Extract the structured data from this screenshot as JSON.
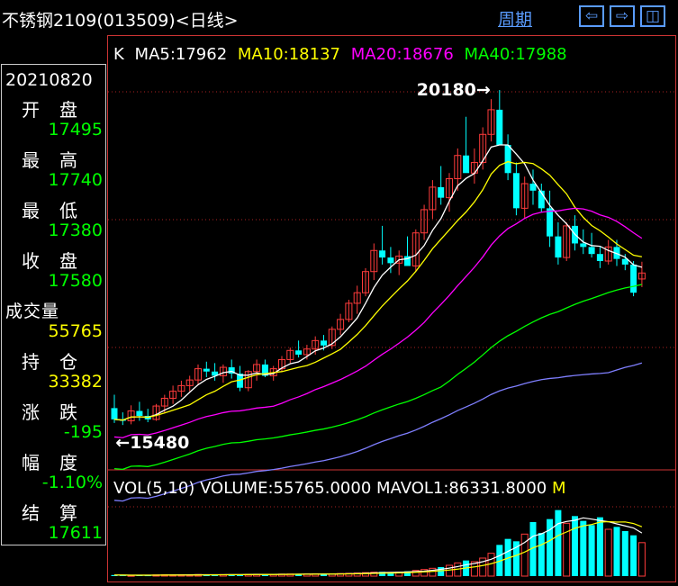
{
  "window": {
    "title": "不锈钢2109(013509)<日线>",
    "period_label": "周期",
    "btn_left": "⇦",
    "btn_right": "⇨",
    "btn_layout": "◫"
  },
  "info_panel": {
    "date": "20210820",
    "open_label": "开盘",
    "open_value": "17495",
    "high_label": "最高",
    "high_value": "17740",
    "low_label": "最低",
    "low_value": "17380",
    "close_label": "收盘",
    "close_value": "17580",
    "volume_label": "成交量",
    "volume_value": "55765",
    "oi_label": "持仓",
    "oi_value": "33382",
    "change_label": "涨跌",
    "change_value": "-195",
    "pct_label": "幅度",
    "pct_value": "-1.10%",
    "settle_label": "结算",
    "settle_value": "17611"
  },
  "colors": {
    "up": "#ff3b3b",
    "down": "#00ffff",
    "ma5": "#ffffff",
    "ma10": "#ffff00",
    "ma20": "#ff00ff",
    "ma40": "#00ff00",
    "ma60": "#7f7fff",
    "value_green": "#00ff00",
    "value_yellow": "#ffff00",
    "value_white": "#ffffff"
  },
  "chart_data": {
    "type": "candlestick",
    "legend": {
      "k": "K",
      "ma5": "MA5:17962",
      "ma10": "MA10:18137",
      "ma20": "MA20:18676",
      "ma40": "MA40:17988",
      "vol": "VOL(5,10)",
      "volume": "VOLUME:55765.0000",
      "mavol1": "MAVOL1:86331.8000",
      "cut": "M"
    },
    "annotations": {
      "max_label": "20180",
      "min_label": "15480"
    },
    "price_range": [
      15000,
      20500
    ],
    "candles": [
      [
        15660,
        15850,
        15450,
        15500
      ],
      [
        15500,
        15600,
        15420,
        15480
      ],
      [
        15480,
        15700,
        15430,
        15620
      ],
      [
        15620,
        15750,
        15480,
        15550
      ],
      [
        15550,
        15650,
        15460,
        15500
      ],
      [
        15500,
        15720,
        15480,
        15690
      ],
      [
        15690,
        15850,
        15600,
        15800
      ],
      [
        15800,
        15980,
        15720,
        15900
      ],
      [
        15900,
        16050,
        15820,
        15980
      ],
      [
        15980,
        16120,
        15900,
        16060
      ],
      [
        16060,
        16280,
        16000,
        16220
      ],
      [
        16220,
        16320,
        16100,
        16180
      ],
      [
        16180,
        16300,
        16050,
        16120
      ],
      [
        16120,
        16280,
        16020,
        16240
      ],
      [
        16240,
        16350,
        16080,
        16150
      ],
      [
        16150,
        16260,
        15900,
        15950
      ],
      [
        15950,
        16200,
        15900,
        16180
      ],
      [
        16180,
        16350,
        16050,
        16280
      ],
      [
        16280,
        16350,
        16100,
        16120
      ],
      [
        16120,
        16260,
        16050,
        16220
      ],
      [
        16220,
        16400,
        16180,
        16350
      ],
      [
        16350,
        16520,
        16300,
        16480
      ],
      [
        16480,
        16620,
        16380,
        16420
      ],
      [
        16420,
        16560,
        16350,
        16500
      ],
      [
        16500,
        16680,
        16420,
        16620
      ],
      [
        16620,
        16700,
        16480,
        16550
      ],
      [
        16550,
        16820,
        16500,
        16780
      ],
      [
        16780,
        17000,
        16700,
        16920
      ],
      [
        16920,
        17200,
        16880,
        17150
      ],
      [
        17150,
        17400,
        17000,
        17300
      ],
      [
        17300,
        17650,
        17250,
        17600
      ],
      [
        17600,
        18000,
        17480,
        17900
      ],
      [
        17900,
        18250,
        17700,
        17800
      ],
      [
        17800,
        17950,
        17580,
        17720
      ],
      [
        17720,
        17900,
        17550,
        17820
      ],
      [
        17820,
        18100,
        17700,
        17680
      ],
      [
        17680,
        18200,
        17600,
        18150
      ],
      [
        18150,
        18550,
        18050,
        18480
      ],
      [
        18480,
        18900,
        18350,
        18800
      ],
      [
        18800,
        19100,
        18550,
        18650
      ],
      [
        18650,
        19000,
        18450,
        18920
      ],
      [
        18920,
        19350,
        18750,
        19250
      ],
      [
        19250,
        19800,
        19050,
        19000
      ],
      [
        19000,
        19350,
        18850,
        19150
      ],
      [
        19150,
        19650,
        19050,
        19550
      ],
      [
        19550,
        20050,
        19450,
        19900
      ],
      [
        19900,
        20180,
        19550,
        19400
      ],
      [
        19400,
        19550,
        18900,
        19000
      ],
      [
        19000,
        19150,
        18400,
        18500
      ],
      [
        18500,
        18950,
        18350,
        18850
      ],
      [
        18850,
        19050,
        18550,
        18750
      ],
      [
        18750,
        18850,
        18450,
        18500
      ],
      [
        18500,
        18750,
        17950,
        18100
      ],
      [
        18100,
        18300,
        17700,
        17800
      ],
      [
        17800,
        18300,
        17750,
        18250
      ],
      [
        18250,
        18400,
        17900,
        18000
      ],
      [
        18000,
        18200,
        17850,
        17950
      ],
      [
        17950,
        18150,
        17800,
        17850
      ],
      [
        17850,
        17950,
        17650,
        17750
      ],
      [
        17750,
        18050,
        17700,
        17950
      ],
      [
        17950,
        18050,
        17680,
        17780
      ],
      [
        17780,
        17850,
        17620,
        17700
      ],
      [
        17700,
        17750,
        17250,
        17300
      ],
      [
        17495,
        17740,
        17380,
        17580
      ]
    ],
    "volumes": [
      1800,
      1500,
      1200,
      1600,
      1400,
      2000,
      2200,
      1900,
      2300,
      2100,
      2600,
      2400,
      2200,
      2500,
      2800,
      2600,
      2900,
      3100,
      2700,
      3000,
      3300,
      3500,
      3200,
      3600,
      3900,
      3400,
      3800,
      4200,
      4600,
      5200,
      5800,
      6500,
      7200,
      6200,
      6800,
      8000,
      9500,
      11000,
      13000,
      15000,
      18000,
      22000,
      26000,
      24000,
      30000,
      38000,
      52000,
      62000,
      58000,
      70000,
      90000,
      72000,
      95000,
      110000,
      88000,
      100000,
      92000,
      85000,
      98000,
      78000,
      82000,
      75000,
      68000,
      55765
    ],
    "volume_range": [
      0,
      120000
    ]
  }
}
